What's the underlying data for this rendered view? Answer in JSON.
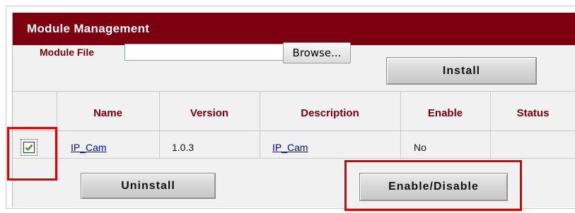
{
  "header": {
    "title": "Module Management"
  },
  "install_row": {
    "label": "Module File",
    "file_value": "",
    "browse_label": "Browse...",
    "install_label": "Install"
  },
  "table": {
    "columns": [
      "Name",
      "Version",
      "Description",
      "Enable",
      "Status"
    ],
    "rows": [
      {
        "checked": true,
        "name": "IP_Cam",
        "version": "1.0.3",
        "description": "IP_Cam",
        "enable": "No",
        "status": ""
      }
    ]
  },
  "actions": {
    "uninstall_label": "Uninstall",
    "enable_disable_label": "Enable/Disable"
  },
  "colors": {
    "header_bg": "#7d0010",
    "label_text": "#7a0010",
    "highlight": "#e00000",
    "link": "#0000cc"
  }
}
